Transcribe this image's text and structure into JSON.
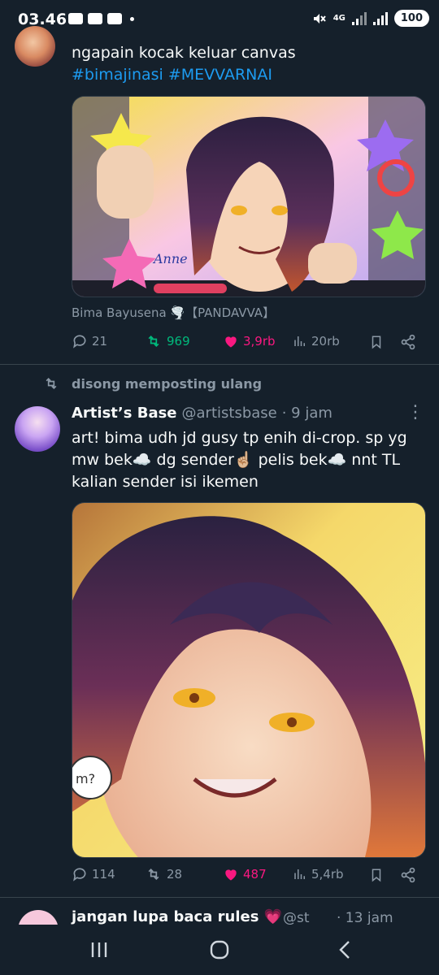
{
  "status_bar": {
    "time": "03.46",
    "network": "4G",
    "battery": "100"
  },
  "tweet1": {
    "text_line": "ngapain kocak keluar canvas",
    "hashtags": "#bimajinasi #MEVVARNAI",
    "caption": "Bima Bayusena 🌪️【PANDAVVA】",
    "replies": "21",
    "retweets": "969",
    "likes": "3,9rb",
    "views": "20rb"
  },
  "retweet_label": "disong memposting ulang",
  "tweet2": {
    "name": "Artist’s Base",
    "handle": "@artistsbase",
    "time": "· 9 jam",
    "text": "art! bima udh jd gusy tp enih di-crop. sp yg mw bek☁️ dg sender☝🏼 pelis bek☁️ nnt TL kalian sender isi ikemen",
    "replies": "114",
    "retweets": "28",
    "likes": "487",
    "views": "5,4rb"
  },
  "tweet3": {
    "name": "jangan lupa baca rules 💗",
    "handle": "@st",
    "time": "· 13 jam"
  },
  "colors": {
    "background": "#15202b",
    "link": "#1d9bf0",
    "retweet_active": "#00ba7c",
    "like_active": "#f91880",
    "muted": "#8b98a5"
  }
}
